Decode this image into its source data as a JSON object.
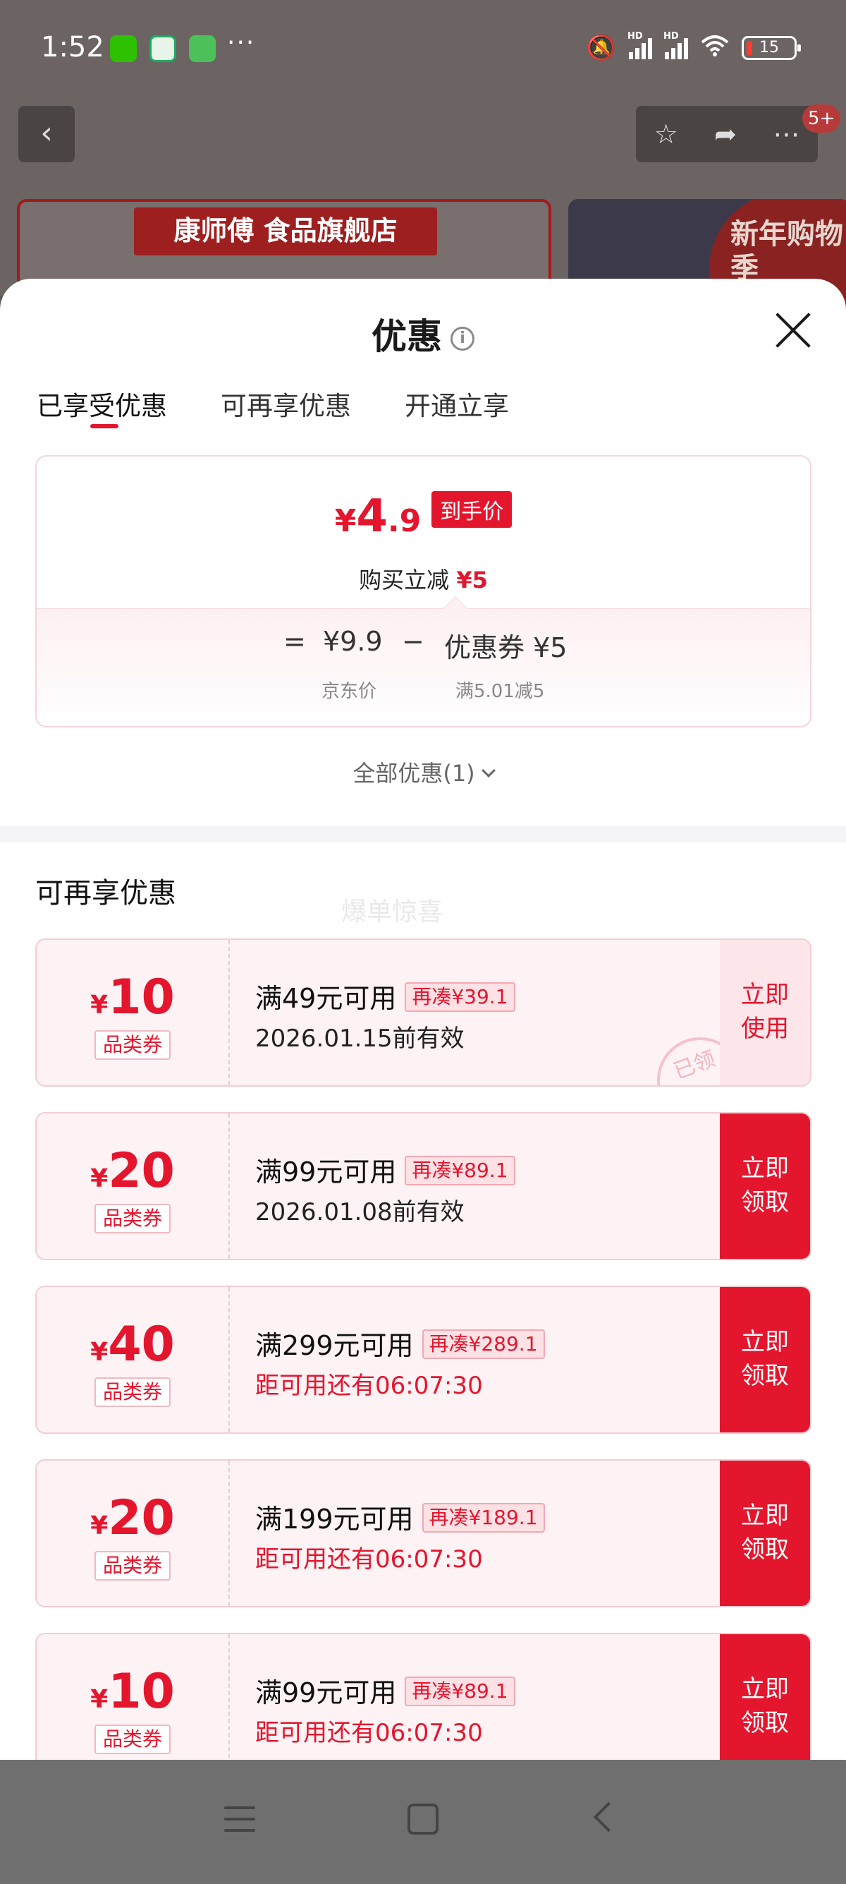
{
  "status": {
    "time": "1:52",
    "dots": "···",
    "signal1_label": "HD",
    "signal2_label": "HD",
    "battery": "15"
  },
  "background": {
    "store_banner": "康师傅 食品旗舰店",
    "promo_banner": "新年购物季",
    "badge": "5+"
  },
  "sheet": {
    "title": "优惠",
    "tabs": [
      "已享受优惠",
      "可再享优惠",
      "开通立享"
    ],
    "active_tab": 0
  },
  "summary": {
    "currency": "¥",
    "final_int": "4",
    "final_dec": ".9",
    "final_tag": "到手价",
    "reduce_label": "购买立减",
    "reduce_value": "¥5",
    "equals": "=",
    "jd_price": "¥9.9",
    "minus": "−",
    "coupon_label": "优惠券 ¥5",
    "jd_price_label": "京东价",
    "coupon_rule": "满5.01减5",
    "all_link": "全部优惠(1)"
  },
  "more_section": {
    "title": "可再享优惠",
    "watermark": "爆单惊喜"
  },
  "coupons": [
    {
      "value": "10",
      "kind": "品类券",
      "condition": "满49元可用",
      "more": "再凑¥39.1",
      "sub": "2026.01.15前有效",
      "btn_line1": "立即",
      "btn_line2": "使用",
      "status": "used",
      "stamp": "已领"
    },
    {
      "value": "20",
      "kind": "品类券",
      "condition": "满99元可用",
      "more": "再凑¥89.1",
      "sub": "2026.01.08前有效",
      "btn_line1": "立即",
      "btn_line2": "领取",
      "status": "claim"
    },
    {
      "value": "40",
      "kind": "品类券",
      "condition": "满299元可用",
      "more": "再凑¥289.1",
      "sub": "距可用还有06:07:30",
      "btn_line1": "立即",
      "btn_line2": "领取",
      "status": "claim"
    },
    {
      "value": "20",
      "kind": "品类券",
      "condition": "满199元可用",
      "more": "再凑¥189.1",
      "sub": "距可用还有06:07:30",
      "btn_line1": "立即",
      "btn_line2": "领取",
      "status": "claim"
    },
    {
      "value": "10",
      "kind": "品类券",
      "condition": "满99元可用",
      "more": "再凑¥89.1",
      "sub": "距可用还有06:07:30",
      "btn_line1": "立即",
      "btn_line2": "领取",
      "status": "claim"
    }
  ],
  "colors": {
    "accent": "#e4162e",
    "coupon_bg": "#fdf2f4",
    "overlay": "#6b6463"
  }
}
